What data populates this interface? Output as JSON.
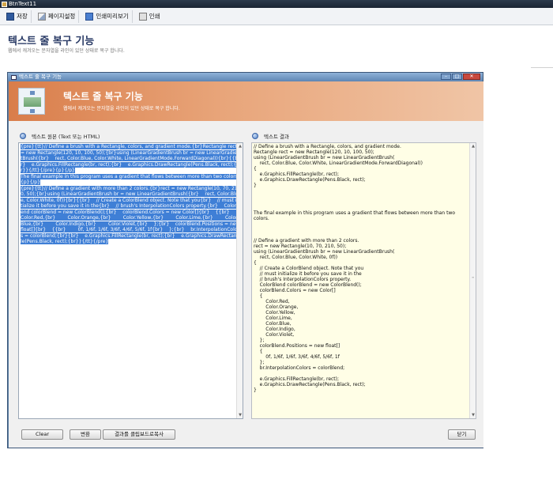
{
  "app": {
    "title": "BtnText11"
  },
  "toolbar": {
    "items": [
      {
        "label": "저장",
        "icon": "save-icon"
      },
      {
        "label": "페이지설정",
        "icon": "page-setup-icon"
      },
      {
        "label": "인쇄미리보기",
        "icon": "print-preview-icon"
      },
      {
        "label": "인쇄",
        "icon": "printer-icon"
      }
    ]
  },
  "page": {
    "title": "텍스트 줄 복구 기능",
    "subtitle": "웹에서 캐겨오는 문자열을 라인이 있던 상태로 복구 합니다."
  },
  "window": {
    "title": "텍스트 줄 복구 기능",
    "banner_title": "텍스트 줄 복구 기능",
    "banner_subtitle": "웹에서 캐겨오는 문자열을 라인이 있던 상태로 복구 합니다.",
    "controls": {
      "minimize": "–",
      "maximize": "□",
      "close": "✕"
    }
  },
  "source_panel": {
    "label": "텍스트 원본 (Text 또는 HTML)",
    "text": "{pre}{tt}// Define a brush with a Rectangle, colors, and gradient mode.{br}Rectangle rect = new Rectangle(120, 10, 100, 50);{br}using (LinearGradientBrush br = new LinearGradientBrush({br}    rect, Color.Blue, Color.White, LinearGradientMode.ForwardDiagonal)){br}{{br}    e.Graphics.FillRectangle(br, rect);{br}    e.Graphics.DrawRectangle(Pens.Black, rect);{br}}{/tt}{/pre}{p}{/p}\nThe final example in this program uses a gradient that flows between more than two colors.\n{p}{/p}\n{pre}{tt}// Define a gradient with more than 2 colors.{br}rect = new Rectangle(10, 70, 210, 50);{br}using (LinearGradientBrush br = new LinearGradientBrush({br}    rect, Color.Blue, Color.White, 0f)){br}{{br}    // Create a ColorBlend object. Note that you{br}    // must initialize it before you save it in the{br}    // brush's InterpolationColors property.{br}    ColorBlend colorBlend = new ColorBlend();{br}    colorBlend.Colors = new Color[]{br}    {{br}        Color.Red,{br}        Color.Orange,{br}        Color.Yellow,{br}        Color.Lime,{br}        Color.Blue,{br}        Color.Indigo,{br}        Color.Violet,{br}    };{br}    colorBlend.Positions = new float[]{br}    {{br}        0f, 1/6f, 1/6f, 3/6f, 4/6f, 5/6f, 1f{br}    };{br}    br.InterpolationColors = colorBlend;{br}{br}    e.Graphics.FillRectangle(br, rect);{br}    e.Graphics.DrawRectangle(Pens.Black, rect);{br}}{/tt}{/pre}"
  },
  "result_panel": {
    "label": "텍스트 결과",
    "text": "// Define a brush with a Rectangle, colors, and gradient mode.\nRectangle rect = new Rectangle(120, 10, 100, 50);\nusing (LinearGradientBrush br = new LinearGradientBrush(\n    rect, Color.Blue, Color.White, LinearGradientMode.ForwardDiagonal))\n{\n    e.Graphics.FillRectangle(br, rect);\n    e.Graphics.DrawRectangle(Pens.Black, rect);\n}\n\n\n\n\nThe final example in this program uses a gradient that flows between more than two\ncolors.\n\n\n\n// Define a gradient with more than 2 colors.\nrect = new Rectangle(10, 70, 210, 50);\nusing (LinearGradientBrush br = new LinearGradientBrush(\n    rect, Color.Blue, Color.White, 0f))\n{\n    // Create a ColorBlend object. Note that you\n    // must initialize it before you save it in the\n    // brush's InterpolationColors property.\n    ColorBlend colorBlend = new ColorBlend();\n    colorBlend.Colors = new Color[]\n    {\n        Color.Red,\n        Color.Orange,\n        Color.Yellow,\n        Color.Lime,\n        Color.Blue,\n        Color.Indigo,\n        Color.Violet,\n    };\n    colorBlend.Positions = new float[]\n    {\n        0f, 1/6f, 1/6f, 3/6f, 4/6f, 5/6f, 1f\n    };\n    br.InterpolationColors = colorBlend;\n\n    e.Graphics.FillRectangle(br, rect);\n    e.Graphics.DrawRectangle(Pens.Black, rect);\n}"
  },
  "buttons": {
    "clear": "Clear",
    "convert": "변환",
    "copy": "결과를 클립보드로복사",
    "close": "닫기"
  },
  "colors": {
    "banner_start": "#d97d4a",
    "selection": "#3f7fd6",
    "result_bg": "#fffee6",
    "heading": "#2a3b66"
  }
}
